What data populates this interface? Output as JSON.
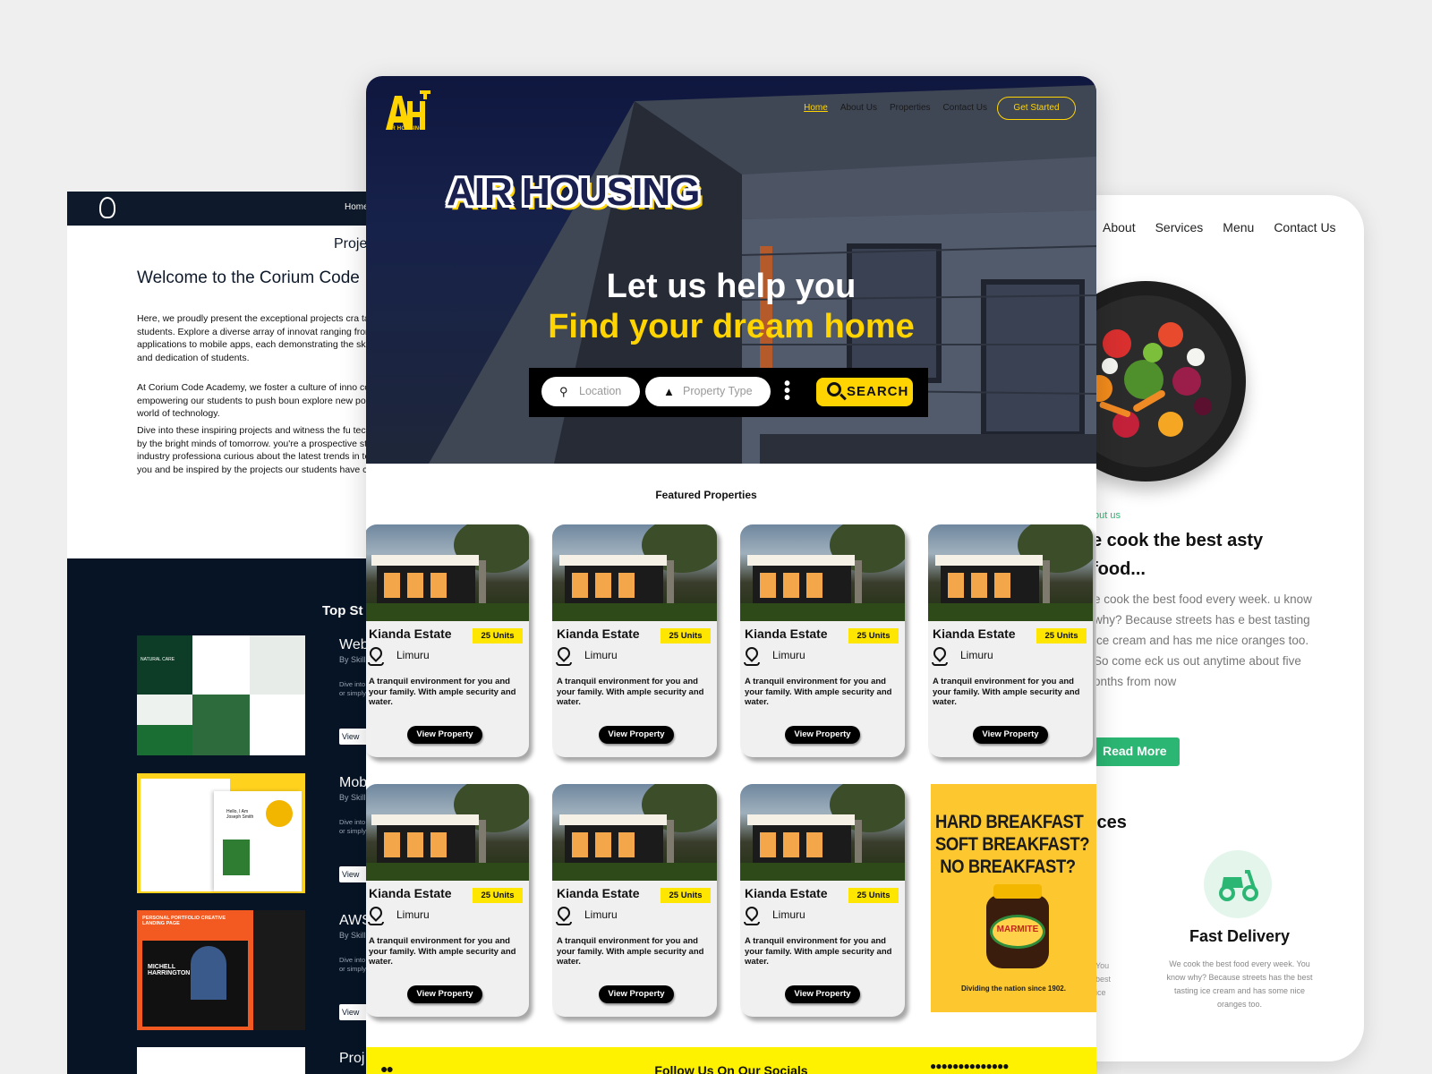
{
  "left_mockup": {
    "nav_home": "Home",
    "projects_heading": "Proje",
    "welcome": "Welcome to the Corium Code",
    "paragraphs": [
      "Here, we proudly present the exceptional projects cra talented students. Explore a diverse array of innovat ranging from web applications to mobile apps, each demonstrating the skill, creativity, and dedication of students.",
      "At Corium Code Academy, we foster a culture of inno collaboration, empowering our students to push boun explore new possibilities in the world of technology.",
      "Dive into these inspiring projects and witness the fu technology, crafted by the bright minds of tomorrow. you're a prospective student, an industry professiona curious about the latest trends in tech, we invite you and be inspired by the projects our students have cre"
    ],
    "top_students": "Top St",
    "projects": [
      {
        "title": "Web",
        "by": "By Skill",
        "desc": "Dive into bright m or simply by the p",
        "btn": "View"
      },
      {
        "title": "Mob",
        "by": "By Skill",
        "desc": "Dive into bright m or simply by the p",
        "btn": "View"
      },
      {
        "title": "AWS",
        "by": "By Skill",
        "desc": "Dive into bright m or simply by the p",
        "btn": "View"
      },
      {
        "title": "Proj",
        "by": "",
        "desc": "",
        "btn": ""
      }
    ],
    "thumb2_label": "Hello, I Am Joseph Smith",
    "thumb3_heading": "PERSONAL PORTFOLIO CREATIVE LANDING PAGE",
    "thumb3_name": "MICHELL HARRINGTON",
    "thumb1_label": "NATURAL CARE"
  },
  "right_mockup": {
    "nav": [
      "About",
      "Services",
      "Menu",
      "Contact Us"
    ],
    "about_tag": "out us",
    "headline": "e cook the best asty food...",
    "body": "e cook the best food every week. u know why? Because streets has e best tasting ice cream and has me nice oranges too. So come eck us out anytime about five onths from now",
    "read_more": "Read More",
    "services_fragment": "ices",
    "feature_title": "Fast Delivery",
    "feature_body": "We cook the best food every week. You know why? Because streets has the best tasting ice cream and has some nice oranges too.",
    "side_text": "You best ice"
  },
  "main": {
    "brand": "AIR HOUSING",
    "brand_mark": "AH",
    "nav": {
      "home": "Home",
      "about": "About Us",
      "properties": "Properties",
      "contact": "Contact Us"
    },
    "get_started": "Get Started",
    "logo_big": "AIR HOUSING",
    "headline_1": "Let us help you",
    "headline_2": "Find your dream home",
    "search": {
      "location": "Location",
      "property_type": "Property Type",
      "button": "SEARCH"
    },
    "featured_title": "Featured Properties",
    "cards": [
      {
        "name": "Kianda Estate",
        "units": "25 Units",
        "location": "Limuru",
        "desc": "A tranquil environment for you and your family. With ample security and water.",
        "btn": "View Property"
      },
      {
        "name": "Kianda Estate",
        "units": "25 Units",
        "location": "Limuru",
        "desc": "A tranquil environment for you and your family. With ample security and water.",
        "btn": "View Property"
      },
      {
        "name": "Kianda Estate",
        "units": "25 Units",
        "location": "Limuru",
        "desc": "A tranquil environment for you and your family. With ample security and water.",
        "btn": "View Property"
      },
      {
        "name": "Kianda Estate",
        "units": "25 Units",
        "location": "Limuru",
        "desc": "A tranquil environment for you and your family. With ample security and water.",
        "btn": "View Property"
      },
      {
        "name": "Kianda Estate",
        "units": "25 Units",
        "location": "Limuru",
        "desc": "A tranquil environment for you and your family. With ample security and water.",
        "btn": "View Property"
      },
      {
        "name": "Kianda Estate",
        "units": "25 Units",
        "location": "Limuru",
        "desc": "A tranquil environment for you and your family. With ample security and water.",
        "btn": "View Property"
      },
      {
        "name": "Kianda Estate",
        "units": "25 Units",
        "location": "Limuru",
        "desc": "A tranquil environment for you and your family. With ample security and water.",
        "btn": "View Property"
      }
    ],
    "ad": {
      "line1": "HARD BREAKFAST",
      "line2": "SOFT BREAKFAST?",
      "line3": "NO BREAKFAST?",
      "brand": "MARMITE",
      "tagline": "Dividing the nation since 1902."
    },
    "footer_follow": "Follow Us On Our Socials"
  },
  "colors": {
    "brand_yellow": "#ffd400",
    "hero_navy": "#0f173f",
    "accent_green": "#2bb673",
    "dark_navy": "#061425"
  }
}
